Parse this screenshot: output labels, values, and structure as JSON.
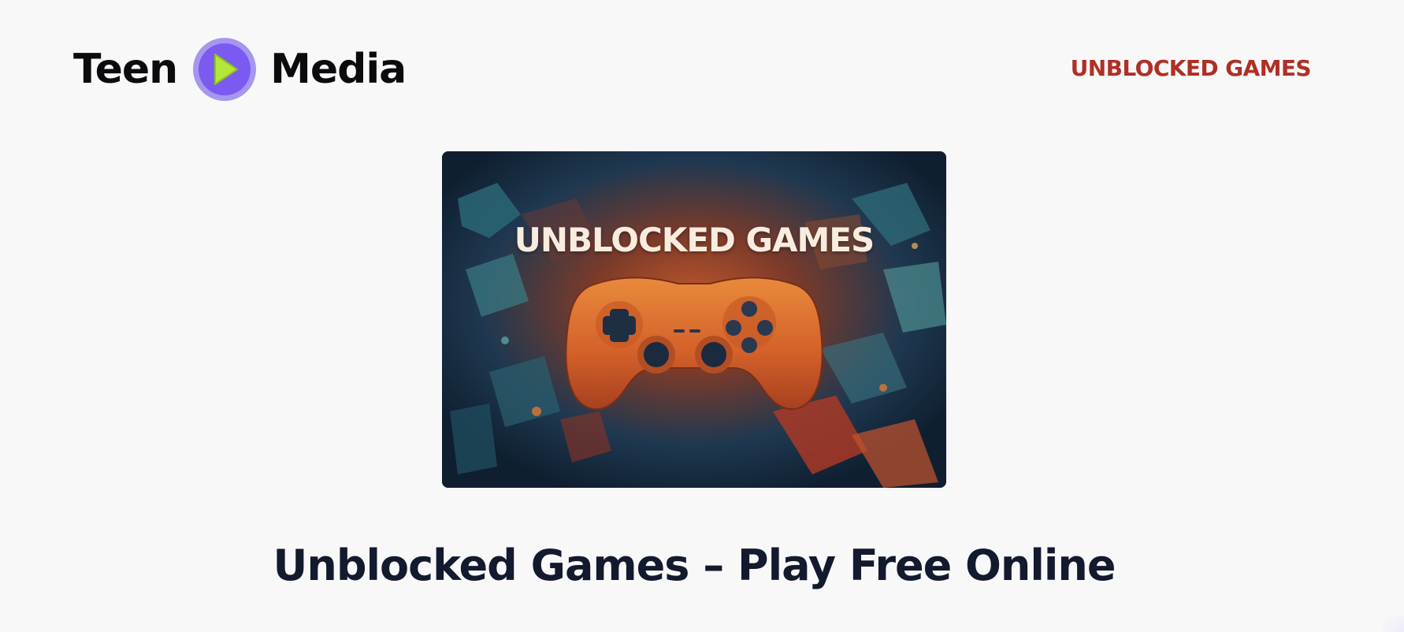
{
  "header": {
    "logo": {
      "word_left": "Teen",
      "word_right": "Media",
      "badge_icon": "play-icon",
      "colors": {
        "badge_outer": "#a596f0",
        "badge_inner": "#7a5af0",
        "play": "#b4e63a"
      }
    },
    "nav": {
      "link_label": "UNBLOCKED GAMES",
      "color": "#b02f25"
    }
  },
  "hero": {
    "image_text": "UNBLOCKED GAMES",
    "icon": "game-controller-icon"
  },
  "main": {
    "title": "Unblocked Games – Play Free Online"
  }
}
